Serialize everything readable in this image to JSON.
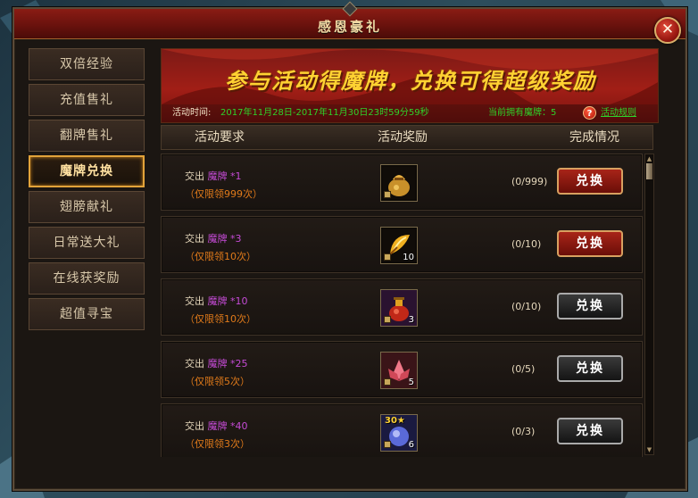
{
  "window": {
    "title": "感恩豪礼",
    "close_glyph": "✕"
  },
  "sidebar": {
    "items": [
      {
        "label": "双倍经验"
      },
      {
        "label": "充值售礼"
      },
      {
        "label": "翻牌售礼"
      },
      {
        "label": "魔牌兑换",
        "active": true
      },
      {
        "label": "翅膀献礼"
      },
      {
        "label": "日常送大礼"
      },
      {
        "label": "在线获奖励"
      },
      {
        "label": "超值寻宝"
      }
    ]
  },
  "banner": {
    "title": "参与活动得魔牌，兑换可得超级奖励",
    "time_label": "活动时间:",
    "time_value": "2017年11月28日-2017年11月30日23时59分59秒",
    "cards_label": "当前拥有魔牌：5",
    "help_glyph": "?",
    "rules_link": "活动规则"
  },
  "table": {
    "headers": [
      "活动要求",
      "活动奖励",
      "完成情况"
    ],
    "rows": [
      {
        "req_prefix": "交出",
        "card_name": "魔牌",
        "card_count": "*1",
        "limit": "（仅限领999次）",
        "reward_icon": "gold-pouch-icon",
        "reward_qty": "",
        "reward_level": "",
        "progress": "(0/999)",
        "button": "兑换",
        "enabled": true
      },
      {
        "req_prefix": "交出",
        "card_name": "魔牌",
        "card_count": "*3",
        "limit": "（仅限领10次）",
        "reward_icon": "golden-feather-icon",
        "reward_qty": "10",
        "reward_level": "",
        "progress": "(0/10)",
        "button": "兑换",
        "enabled": true
      },
      {
        "req_prefix": "交出",
        "card_name": "魔牌",
        "card_count": "*10",
        "limit": "（仅限领10次）",
        "reward_icon": "red-potion-icon",
        "reward_qty": "3",
        "reward_level": "",
        "progress": "(0/10)",
        "button": "兑换",
        "enabled": false
      },
      {
        "req_prefix": "交出",
        "card_name": "魔牌",
        "card_count": "*25",
        "limit": "（仅限领5次）",
        "reward_icon": "red-lotus-icon",
        "reward_qty": "5",
        "reward_level": "",
        "progress": "(0/5)",
        "button": "兑换",
        "enabled": false
      },
      {
        "req_prefix": "交出",
        "card_name": "魔牌",
        "card_count": "*40",
        "limit": "（仅限领3次）",
        "reward_icon": "soul-orb-icon",
        "reward_qty": "6",
        "reward_level": "30★",
        "progress": "(0/3)",
        "button": "兑换",
        "enabled": false
      }
    ]
  },
  "scrollbar": {
    "up_glyph": "▲",
    "down_glyph": "▼"
  },
  "colors": {
    "accent_gold": "#ffd232",
    "card_purple": "#c54bd6",
    "limit_orange": "#e07a1a",
    "time_green": "#2fd22a"
  }
}
